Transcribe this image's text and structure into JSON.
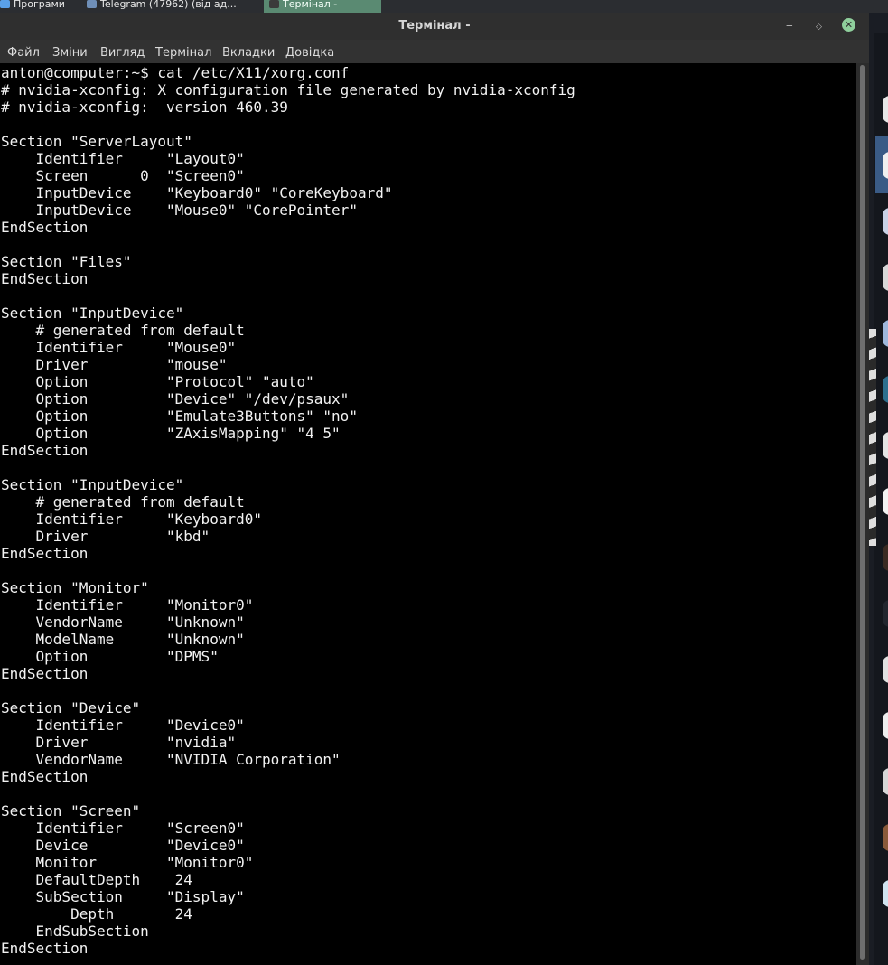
{
  "taskbar": {
    "items": [
      {
        "label": "Програми"
      },
      {
        "label": "Telegram (47962) (від ад..."
      },
      {
        "label": "Термінал -"
      }
    ]
  },
  "window": {
    "title": "Термінал -",
    "controls": {
      "minimize": "‒",
      "maximize": "◇",
      "close": "✕"
    }
  },
  "menubar": {
    "items": [
      "Файл",
      "Зміни",
      "Вигляд",
      "Термінал",
      "Вкладки",
      "Довідка"
    ]
  },
  "terminal": {
    "lines": [
      "anton@computer:~$ cat /etc/X11/xorg.conf",
      "# nvidia-xconfig: X configuration file generated by nvidia-xconfig",
      "# nvidia-xconfig:  version 460.39",
      "",
      "Section \"ServerLayout\"",
      "    Identifier     \"Layout0\"",
      "    Screen      0  \"Screen0\"",
      "    InputDevice    \"Keyboard0\" \"CoreKeyboard\"",
      "    InputDevice    \"Mouse0\" \"CorePointer\"",
      "EndSection",
      "",
      "Section \"Files\"",
      "EndSection",
      "",
      "Section \"InputDevice\"",
      "    # generated from default",
      "    Identifier     \"Mouse0\"",
      "    Driver         \"mouse\"",
      "    Option         \"Protocol\" \"auto\"",
      "    Option         \"Device\" \"/dev/psaux\"",
      "    Option         \"Emulate3Buttons\" \"no\"",
      "    Option         \"ZAxisMapping\" \"4 5\"",
      "EndSection",
      "",
      "Section \"InputDevice\"",
      "    # generated from default",
      "    Identifier     \"Keyboard0\"",
      "    Driver         \"kbd\"",
      "EndSection",
      "",
      "Section \"Monitor\"",
      "    Identifier     \"Monitor0\"",
      "    VendorName     \"Unknown\"",
      "    ModelName      \"Unknown\"",
      "    Option         \"DPMS\"",
      "EndSection",
      "",
      "Section \"Device\"",
      "    Identifier     \"Device0\"",
      "    Driver         \"nvidia\"",
      "    VendorName     \"NVIDIA Corporation\"",
      "EndSection",
      "",
      "Section \"Screen\"",
      "    Identifier     \"Screen0\"",
      "    Device         \"Device0\"",
      "    Monitor        \"Monitor0\"",
      "    DefaultDepth    24",
      "    SubSection     \"Display\"",
      "        Depth       24",
      "    EndSubSection",
      "EndSection"
    ]
  },
  "colors": {
    "terminal_bg": "#000000",
    "terminal_fg": "#f2f2f2",
    "chrome_bg": "#323232",
    "active_task": "#5a8a72",
    "close_button": "#8fcf9c"
  }
}
